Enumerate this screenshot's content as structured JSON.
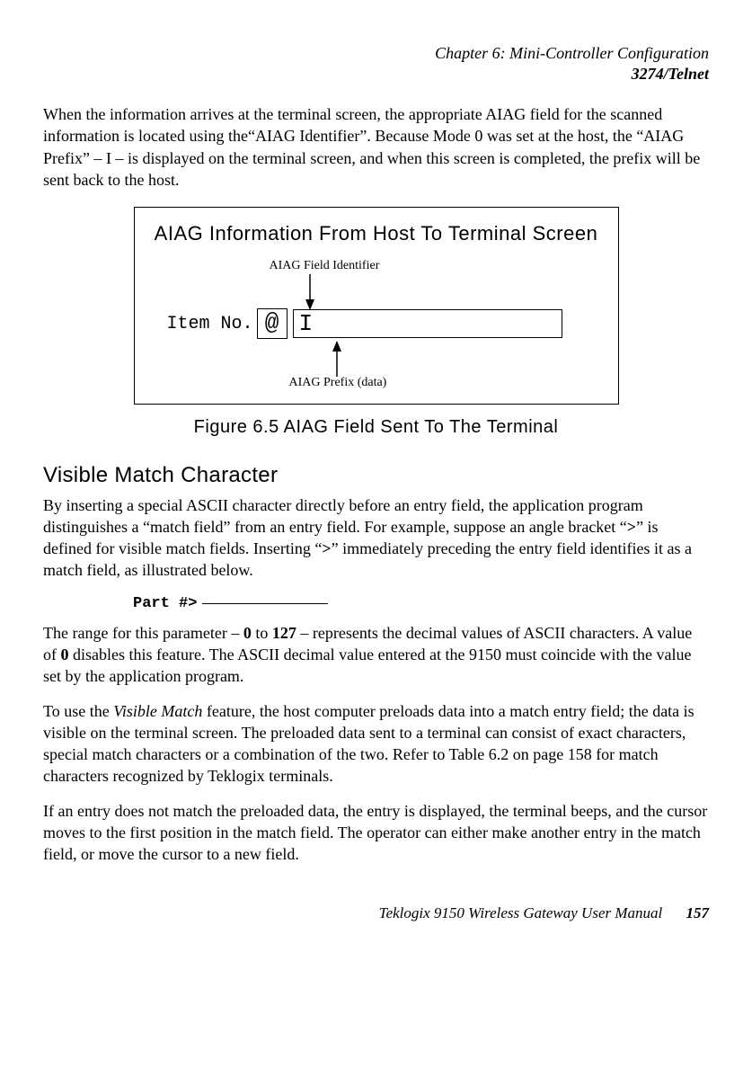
{
  "header": {
    "chapter": "Chapter 6:  Mini-Controller Configuration",
    "section": "3274/Telnet"
  },
  "para1": "When the information arrives at the terminal screen, the appropriate AIAG field for the scanned information is located using the“AIAG Identifier”. Because Mode 0 was set at the host, the “AIAG Prefix” – I – is displayed on the terminal screen, and when this screen is completed, the prefix will be sent back to the host.",
  "figure": {
    "title": "AIAG Information From Host To Terminal Screen",
    "top_label": "AIAG Field Identifier",
    "item_label": "Item No.",
    "at_box": "@",
    "i_box": "I",
    "bottom_label": "AIAG Prefix (data)",
    "caption": "Figure 6.5 AIAG Field Sent To The Terminal"
  },
  "section_heading": "Visible Match Character",
  "para2_a": "By inserting a special ASCII character directly before an entry field, the application program distinguishes a “match field” from an entry field. For example, suppose an angle bracket “",
  "para2_b": ">",
  "para2_c": "” is defined for visible match fields. Inserting “",
  "para2_d": ">",
  "para2_e": "” immediately preceding the entry field identifies it as a match field, as illustrated below.",
  "example_label": "Part #>",
  "para3_a": "The range for this parameter – ",
  "para3_b": "0",
  "para3_c": " to ",
  "para3_d": "127",
  "para3_e": " – represents the decimal values of ASCII characters. A value of ",
  "para3_f": "0",
  "para3_g": " disables this feature. The ASCII decimal value entered at the 9150 must coincide with the value set by the application program.",
  "para4_a": "To use the ",
  "para4_b": "Visible Match",
  "para4_c": " feature, the host computer preloads data into a match entry field; the data is visible on the terminal screen. The preloaded data sent to a terminal can consist of exact characters, special match characters or a combination of the two. Refer to Table 6.2 on page 158 for match characters recognized by Teklogix terminals.",
  "para5": "If an entry does not match the preloaded data, the entry is displayed, the terminal beeps, and the cursor moves to the first position in the match field. The operator can either make another entry in the match field, or move the cursor to a new field.",
  "footer": {
    "manual": "Teklogix 9150 Wireless Gateway User Manual",
    "page": "157"
  }
}
